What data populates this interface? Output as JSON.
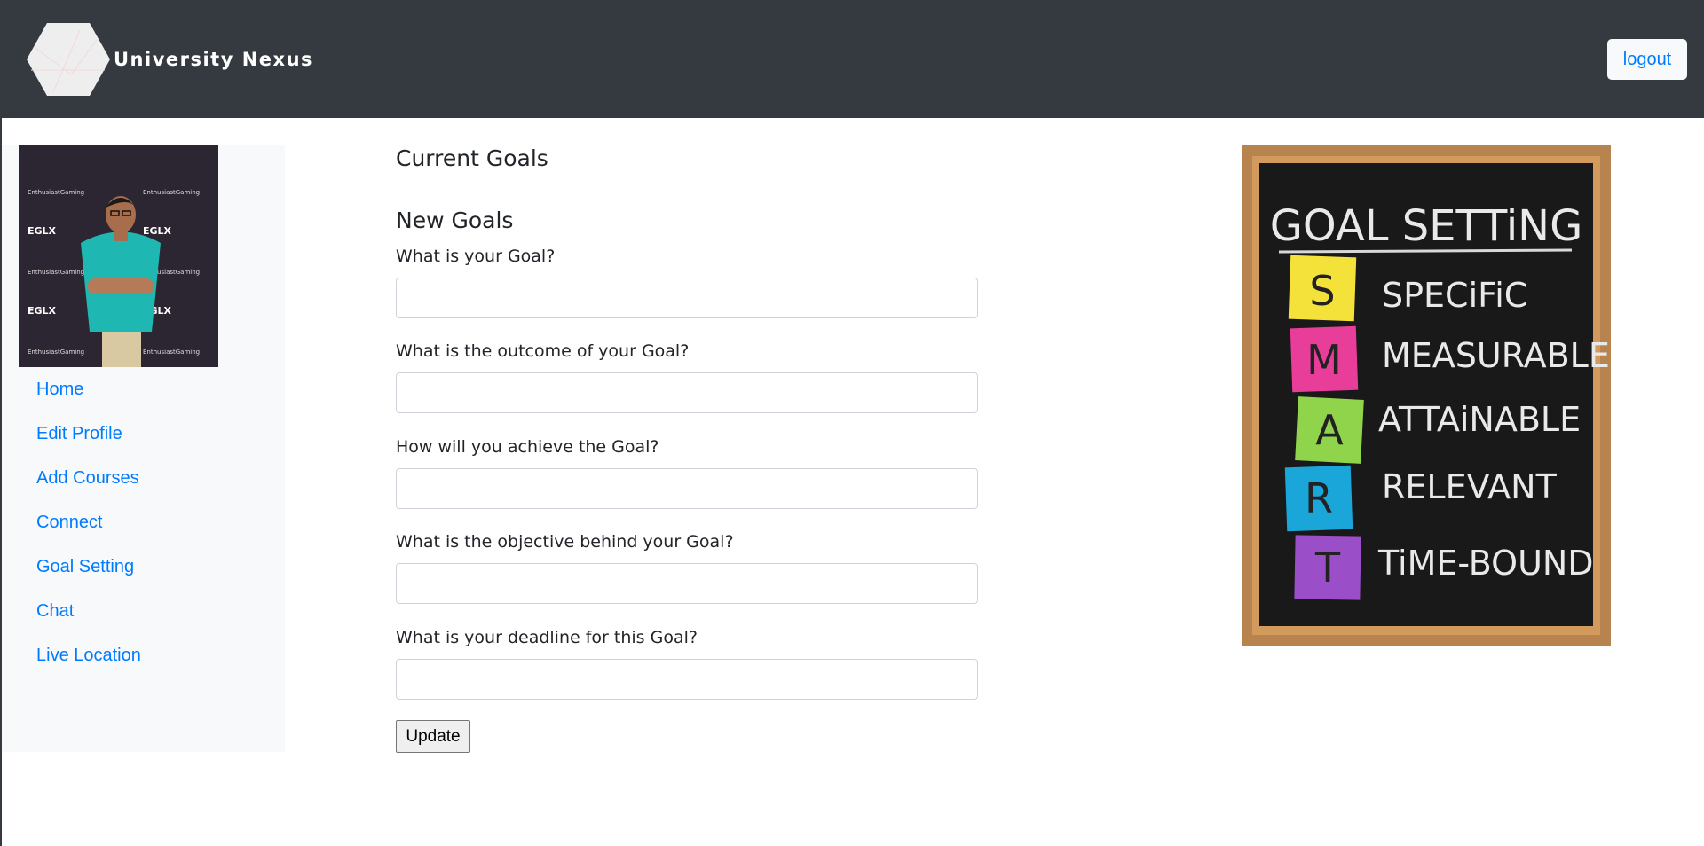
{
  "header": {
    "brand_name": "University Nexus",
    "logout_label": "logout"
  },
  "sidebar": {
    "items": [
      {
        "label": "Home"
      },
      {
        "label": "Edit Profile"
      },
      {
        "label": "Add Courses"
      },
      {
        "label": "Connect"
      },
      {
        "label": "Goal Setting"
      },
      {
        "label": "Chat"
      },
      {
        "label": "Live Location"
      }
    ],
    "avatar_text": [
      "EnthusiastGaming",
      "EGLX"
    ]
  },
  "main": {
    "current_goals_title": "Current Goals",
    "new_goals_title": "New Goals",
    "fields": [
      {
        "label": "What is your Goal?",
        "value": ""
      },
      {
        "label": "What is the outcome of your Goal?",
        "value": ""
      },
      {
        "label": "How will you achieve the Goal?",
        "value": ""
      },
      {
        "label": "What is the objective behind your Goal?",
        "value": ""
      },
      {
        "label": "What is your deadline for this Goal?",
        "value": ""
      }
    ],
    "update_label": "Update"
  },
  "image": {
    "title": "GOAL SETTiNG",
    "rows": [
      {
        "letter": "S",
        "word": "SPECiFiC",
        "color": "#f4e23a"
      },
      {
        "letter": "M",
        "word": "MEASURABLE",
        "color": "#e83e9a"
      },
      {
        "letter": "A",
        "word": "ATTAiNABLE",
        "color": "#8fd44a"
      },
      {
        "letter": "R",
        "word": "RELEVANT",
        "color": "#1aa6d8"
      },
      {
        "letter": "T",
        "word": "TiME-BOUND",
        "color": "#9a4fc8"
      }
    ]
  },
  "colors": {
    "navbar": "#343a40",
    "link": "#007bff",
    "sidebar_bg": "#f8f9fa"
  }
}
